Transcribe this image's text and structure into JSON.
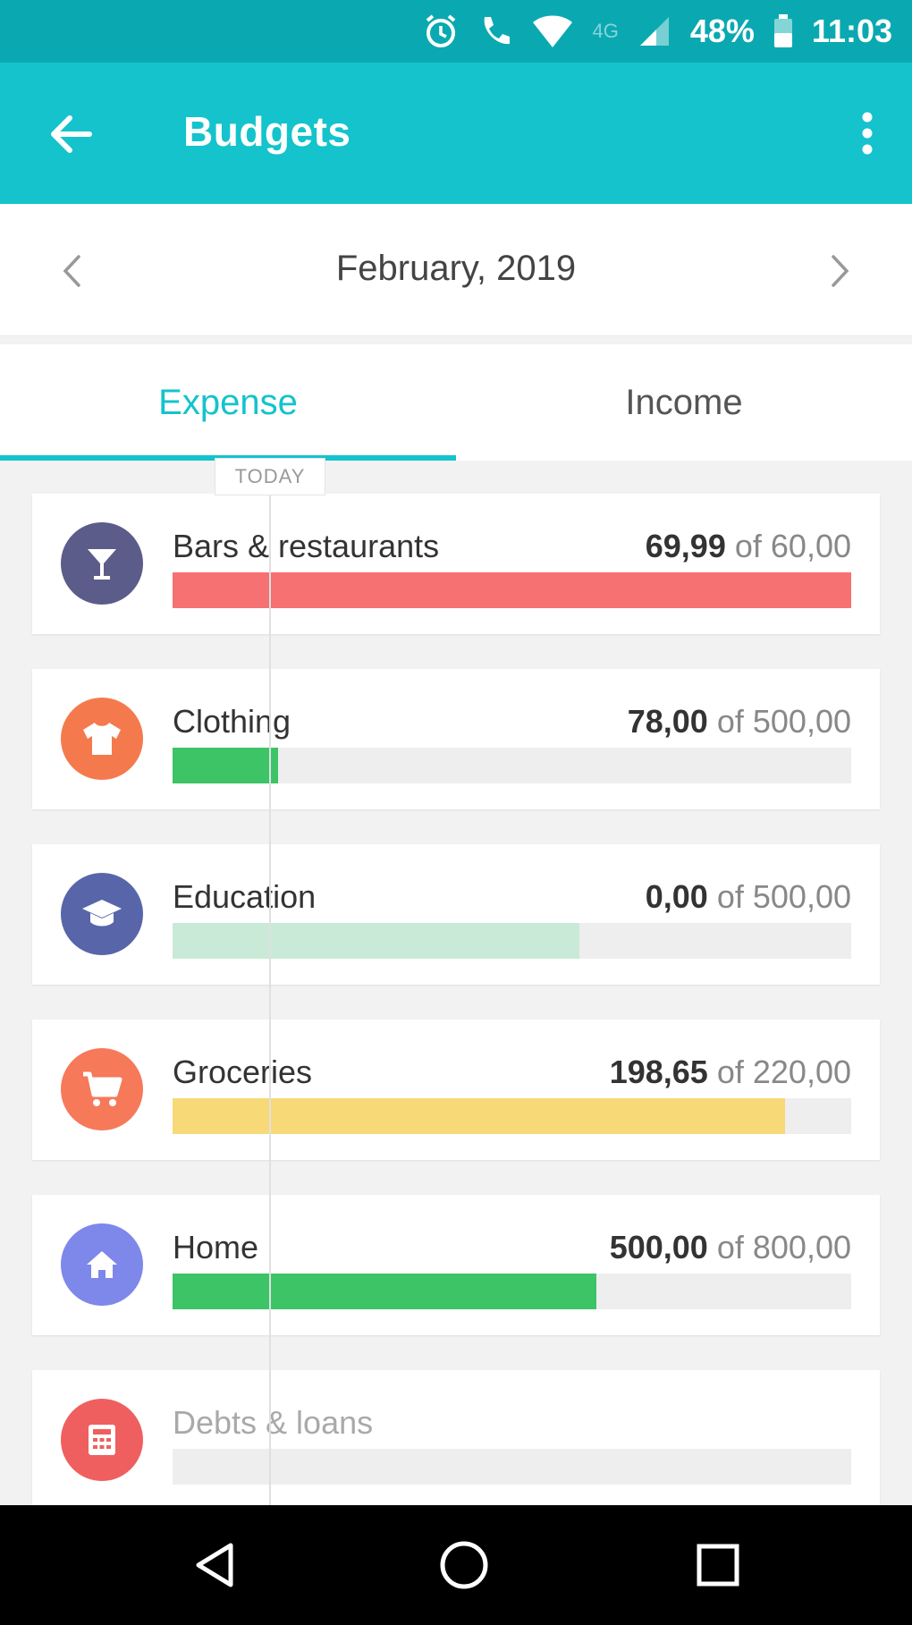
{
  "status_bar": {
    "network": "4G",
    "battery": "48%",
    "time": "11:03",
    "icons": [
      "alarm-icon",
      "call-icon",
      "wifi-icon",
      "signal-icon",
      "battery-icon"
    ]
  },
  "app_bar": {
    "title": "Budgets",
    "back_icon": "arrow-left-icon",
    "more_icon": "more-vertical-icon"
  },
  "month_nav": {
    "label": "February, 2019",
    "prev_icon": "chevron-left-icon",
    "next_icon": "chevron-right-icon"
  },
  "tabs": [
    {
      "label": "Expense",
      "active": true
    },
    {
      "label": "Income",
      "active": false
    }
  ],
  "today_label": "TODAY",
  "budgets": [
    {
      "name": "Bars & restaurants",
      "spent": "69,99",
      "of": "of",
      "limit": "60,00",
      "progress": 1.0,
      "bar_color": "#f67171",
      "icon": "cocktail-icon",
      "icon_bg": "#5c5c8a"
    },
    {
      "name": "Clothing",
      "spent": "78,00",
      "of": "of",
      "limit": "500,00",
      "progress": 0.156,
      "bar_color": "#3cc467",
      "icon": "shirt-icon",
      "icon_bg": "#f47a4e"
    },
    {
      "name": "Education",
      "spent": "0,00",
      "of": "of",
      "limit": "500,00",
      "progress": 0.6,
      "bar_color": "#c9ead6",
      "icon": "graduation-cap-icon",
      "icon_bg": "#5865a9"
    },
    {
      "name": "Groceries",
      "spent": "198,65",
      "of": "of",
      "limit": "220,00",
      "progress": 0.903,
      "bar_color": "#f8d978",
      "icon": "shopping-cart-icon",
      "icon_bg": "#f6795a"
    },
    {
      "name": "Home",
      "spent": "500,00",
      "of": "of",
      "limit": "800,00",
      "progress": 0.625,
      "bar_color": "#3cc467",
      "icon": "home-icon",
      "icon_bg": "#7e87ea"
    },
    {
      "name": "Debts & loans",
      "spent": "",
      "of": "",
      "limit": "",
      "progress": 0,
      "bar_color": "#eeeeee",
      "icon": "calculator-icon",
      "icon_bg": "#ef5f5f"
    }
  ],
  "nav_bar": [
    "back-triangle-icon",
    "home-circle-icon",
    "recents-square-icon"
  ]
}
